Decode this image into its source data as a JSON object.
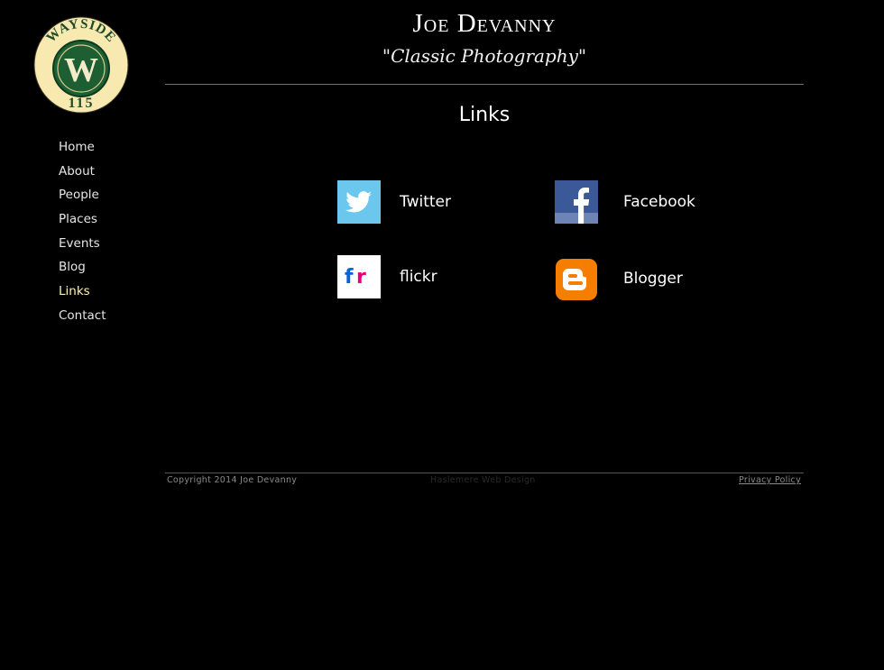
{
  "logo": {
    "top_text": "WAYSIDE",
    "letter": "W",
    "bottom_text": "115",
    "colors": {
      "cream": "#f7e9b0",
      "green": "#1e5e33",
      "dark": "#0d3b1f"
    }
  },
  "nav": {
    "items": [
      {
        "label": "Home",
        "active": false
      },
      {
        "label": "About",
        "active": false
      },
      {
        "label": "People",
        "active": false
      },
      {
        "label": "Places",
        "active": false
      },
      {
        "label": "Events",
        "active": false
      },
      {
        "label": "Blog",
        "active": false
      },
      {
        "label": "Links",
        "active": true
      },
      {
        "label": "Contact",
        "active": false
      }
    ]
  },
  "header": {
    "title": "Joe Devanny",
    "subtitle": "\"Classic Photography\""
  },
  "page": {
    "title": "Links"
  },
  "links": [
    {
      "label": "Twitter",
      "icon": "twitter-icon",
      "color": "#6cc7ee"
    },
    {
      "label": "Facebook",
      "icon": "facebook-icon",
      "color": "#3b5998"
    },
    {
      "label": "flickr",
      "icon": "flickr-icon",
      "color": "#ffffff"
    },
    {
      "label": "Blogger",
      "icon": "blogger-icon",
      "color": "#f57d00"
    }
  ],
  "footer": {
    "copyright": "Copyright 2014 Joe Devanny",
    "designer": "Haslemere Web Design",
    "privacy": "Privacy Policy"
  }
}
